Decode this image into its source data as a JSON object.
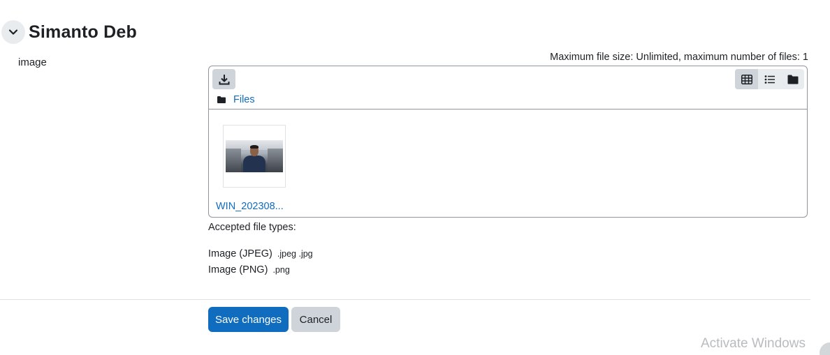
{
  "section": {
    "title": "Simanto Deb",
    "collapse_icon": "chevron-down-icon"
  },
  "field": {
    "label": "image"
  },
  "filepicker": {
    "restrictions": "Maximum file size: Unlimited, maximum number of files: 1",
    "toolbar": {
      "download_icon": "download-icon",
      "view_icons": [
        "grid-view-icon",
        "list-view-icon",
        "tree-view-icon"
      ],
      "active_view": "grid-view-icon"
    },
    "breadcrumb": {
      "icon": "folder-icon",
      "label": "Files"
    },
    "files": [
      {
        "name": "WIN_202308..."
      }
    ]
  },
  "accepted": {
    "title": "Accepted file types:",
    "types": [
      {
        "name": "Image (JPEG)",
        "extensions": ".jpeg .jpg"
      },
      {
        "name": "Image (PNG)",
        "extensions": ".png"
      }
    ]
  },
  "actions": {
    "save_label": "Save changes",
    "cancel_label": "Cancel"
  },
  "watermark": {
    "text": "Activate Windows"
  },
  "colors": {
    "primary": "#0f6cbf",
    "secondary_button": "#ced4da",
    "text": "#1d2125",
    "border": "#8f959e"
  }
}
